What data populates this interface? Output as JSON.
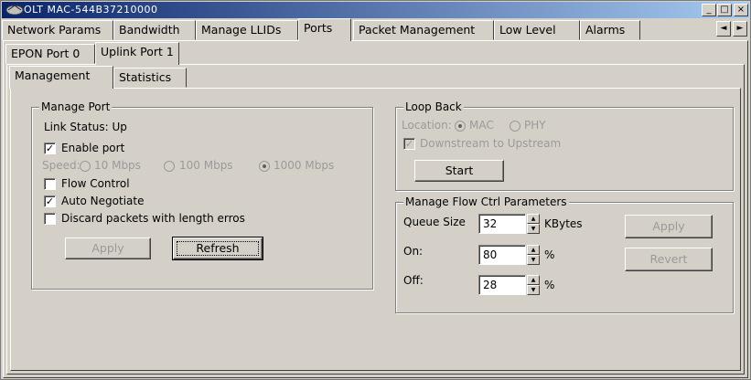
{
  "window": {
    "title": "OLT MAC-544B37210000",
    "minimize": "_",
    "maximize": "□",
    "close": "×"
  },
  "tabs": [
    "Network Params",
    "Bandwidth",
    "Manage LLIDs",
    "Ports",
    "Packet Management",
    "Low Level",
    "Alarms"
  ],
  "tab_scroll": {
    "left": "◄",
    "right": "►"
  },
  "port_tabs": [
    "EPON Port 0",
    "Uplink Port 1"
  ],
  "sub_tabs": [
    "Management",
    "Statistics"
  ],
  "manage_port": {
    "legend": "Manage Port",
    "link_status": "Link Status: Up",
    "enable_port": "Enable port",
    "enable_port_checked": true,
    "speed_label": "Speed:",
    "speed_options": [
      "10 Mbps",
      "100 Mbps",
      "1000 Mbps"
    ],
    "speed_selected": "1000 Mbps",
    "flow_control": "Flow Control",
    "flow_control_checked": false,
    "auto_negotiate": "Auto Negotiate",
    "auto_negotiate_checked": true,
    "discard": "Discard packets with length erros",
    "discard_checked": false,
    "apply": "Apply",
    "refresh": "Refresh"
  },
  "loop_back": {
    "legend": "Loop Back",
    "location_label": "Location:",
    "location_options": [
      "MAC",
      "PHY"
    ],
    "location_selected": "MAC",
    "downstream": "Downstream to Upstream",
    "downstream_checked": true,
    "start": "Start"
  },
  "flow_ctrl": {
    "legend": "Manage Flow Ctrl Parameters",
    "queue_label": "Queue Size",
    "queue_value": "32",
    "queue_unit": "KBytes",
    "on_label": "On:",
    "on_value": "80",
    "on_unit": "%",
    "off_label": "Off:",
    "off_value": "28",
    "off_unit": "%",
    "apply": "Apply",
    "revert": "Revert"
  }
}
